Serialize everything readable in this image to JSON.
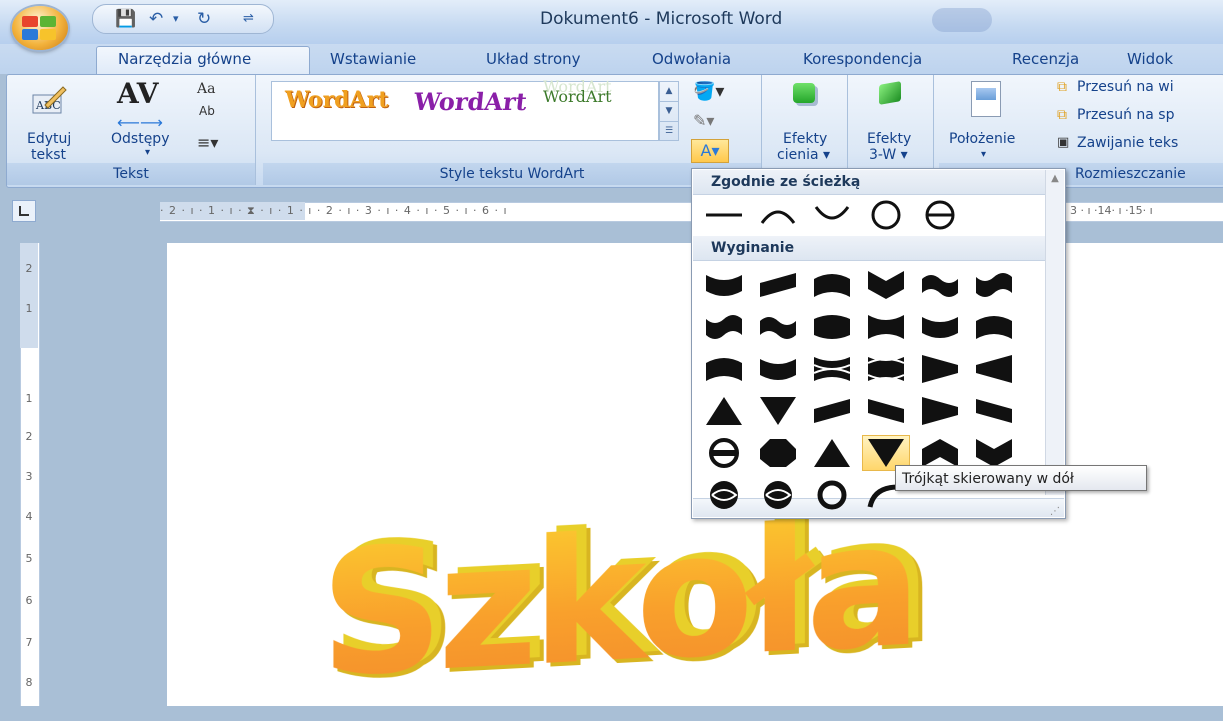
{
  "window": {
    "title": "Dokument6 - Microsoft Word"
  },
  "tabs": [
    {
      "label": "Narzędzia główne"
    },
    {
      "label": "Wstawianie"
    },
    {
      "label": "Układ strony"
    },
    {
      "label": "Odwołania"
    },
    {
      "label": "Korespondencja"
    },
    {
      "label": "Recenzja"
    },
    {
      "label": "Widok"
    }
  ],
  "active_tab": "Narzędzia główne",
  "ribbon": {
    "tekst_group": {
      "label": "Tekst",
      "edytuj_line1": "Edytuj",
      "edytuj_line2": "tekst",
      "odstepy": "Odstępy",
      "av_glyph": "AV",
      "aa_glyph": "Aa",
      "ab_glyph": "Ab"
    },
    "style_group": {
      "label": "Style tekstu WordArt",
      "samples": [
        "WordArt",
        "WordArt",
        "WordArt"
      ]
    },
    "efekty_cienia": {
      "line1": "Efekty",
      "line2": "cienia ▾"
    },
    "efekty_3w": {
      "line1": "Efekty",
      "line2": "3-W ▾"
    },
    "polozenie": "Położenie",
    "arrange": {
      "item1": "Przesuń na wi",
      "item2": "Przesuń na sp",
      "item3": "Zawijanie teks",
      "label": "Rozmieszczanie"
    }
  },
  "ruler": {
    "horizontal_text": "· 2 · ı · 1 · ı · ⧗ · ı · 1 · ı · 2 · ı · 3 · ı · 4 · ı · 5 · ı · 6 · ı",
    "horizontal_tail": "3 · ı ·14· ı ·15· ı",
    "vertical_numbers": [
      "2",
      "1",
      "1",
      "2",
      "3",
      "4",
      "5",
      "6",
      "7",
      "8"
    ]
  },
  "document": {
    "wordart_text": "Szkoła"
  },
  "dropdown": {
    "section1": "Zgodnie ze ścieżką",
    "section2": "Wyginanie",
    "highlighted": "Trójkąt skierowany w dół"
  },
  "tooltip": "Trójkąt skierowany w dół",
  "colors": {
    "accent": "#15428b",
    "ribbon_bg": "#dbe7f5",
    "highlight": "#ffd66b",
    "wordart_orange": "#f9a02c",
    "wordart_yellow": "#fbd230"
  }
}
